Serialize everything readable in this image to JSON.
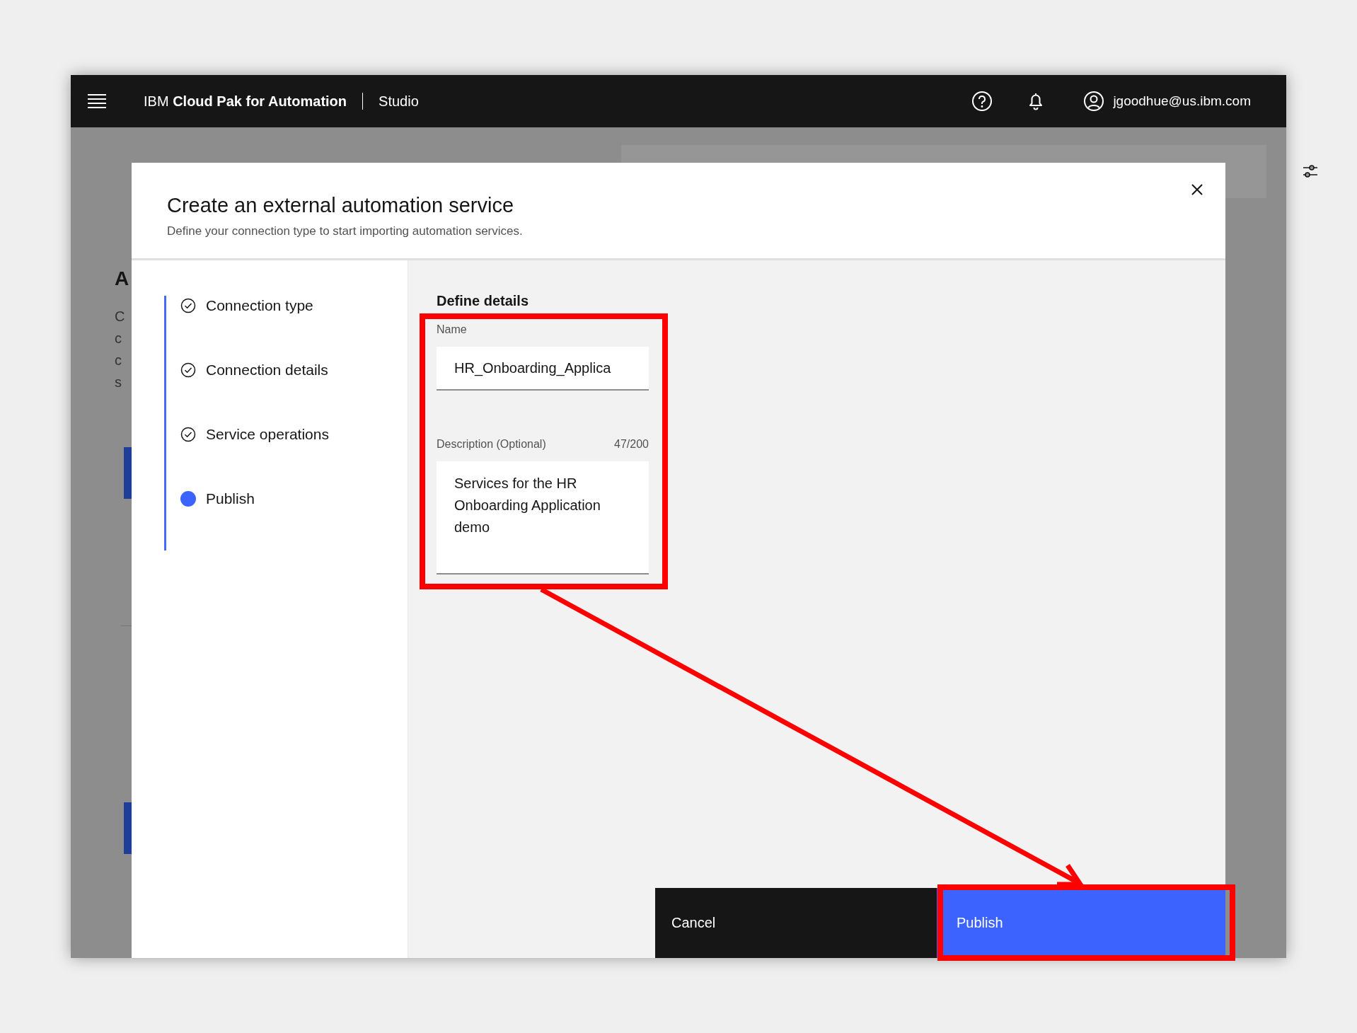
{
  "header": {
    "product_prefix": "IBM",
    "product_name": "Cloud Pak for Automation",
    "section": "Studio",
    "user": "jgoodhue@us.ibm.com"
  },
  "background": {
    "fragments": [
      "A",
      "C",
      "c",
      "c",
      "s"
    ]
  },
  "modal": {
    "title": "Create an external automation service",
    "subtitle": "Define your connection type to start importing automation services.",
    "steps": [
      {
        "label": "Connection type",
        "kind": "complete"
      },
      {
        "label": "Connection details",
        "kind": "complete"
      },
      {
        "label": "Service operations",
        "kind": "complete"
      },
      {
        "label": "Publish",
        "kind": "current"
      }
    ],
    "section_title": "Define details",
    "name_field": {
      "label": "Name",
      "value": "HR_Onboarding_Applica"
    },
    "description_field": {
      "label": "Description (Optional)",
      "counter": "47/200",
      "value": "Services for the HR Onboarding Application demo"
    },
    "buttons": [
      {
        "label": "Cancel",
        "kind": "secondary"
      },
      {
        "label": "Publish",
        "kind": "primary"
      }
    ]
  }
}
